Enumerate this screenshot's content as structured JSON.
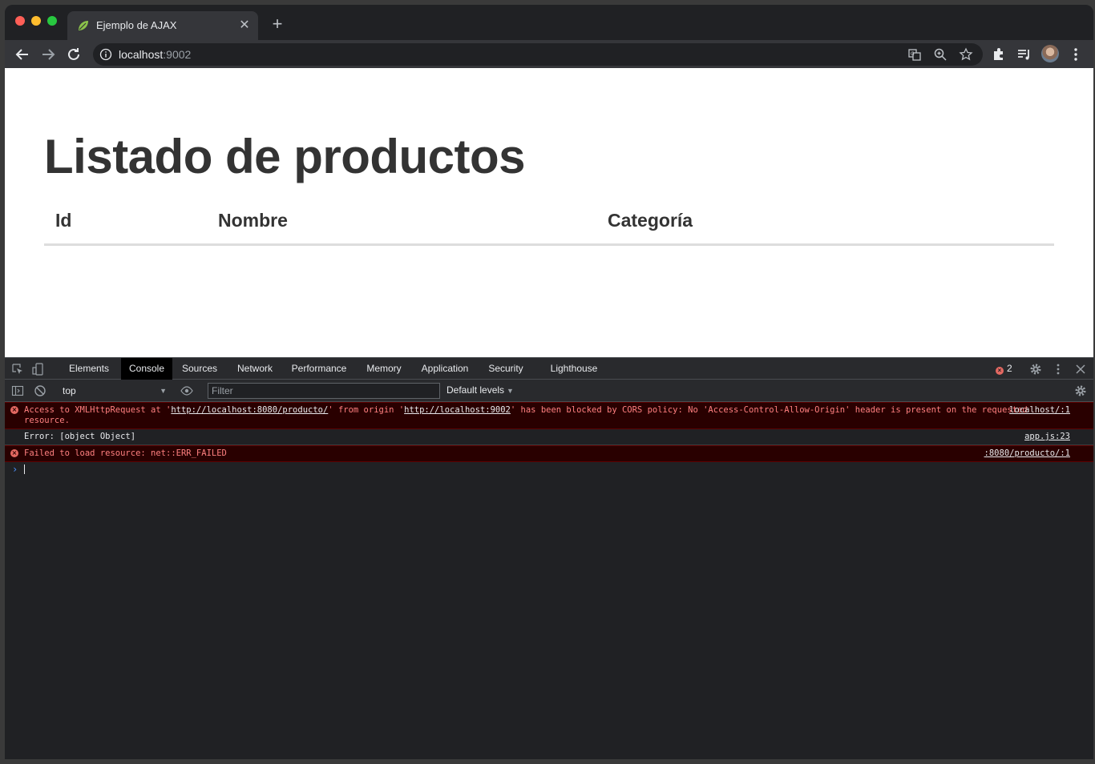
{
  "browser": {
    "tab_title": "Ejemplo de AJAX",
    "url_host": "localhost",
    "url_port": ":9002"
  },
  "page": {
    "title": "Listado de productos",
    "table_headers": [
      "Id",
      "Nombre",
      "Categoría"
    ]
  },
  "devtools": {
    "tabs": [
      "Elements",
      "Console",
      "Sources",
      "Network",
      "Performance",
      "Memory",
      "Application",
      "Security",
      "Lighthouse"
    ],
    "active_tab": "Console",
    "error_count": "2",
    "context": "top",
    "filter_placeholder": "Filter",
    "levels": "Default levels",
    "messages": [
      {
        "type": "error",
        "parts": [
          "Access to XMLHttpRequest at '",
          "http://localhost:8080/producto/",
          "' from origin '",
          "http://localhost:9002",
          "' has been blocked by CORS policy: No 'Access-Control-Allow-Origin' header is present on the requested resource."
        ],
        "source": "localhost/:1"
      },
      {
        "type": "log",
        "text": "Error: [object Object]",
        "source": "app.js:23"
      },
      {
        "type": "error",
        "text": "Failed to load resource: net::ERR_FAILED",
        "source": ":8080/producto/:1"
      }
    ]
  },
  "colors": {
    "error_text": "#ff8080",
    "error_bg": "#290000",
    "page_heading": "#333333"
  }
}
